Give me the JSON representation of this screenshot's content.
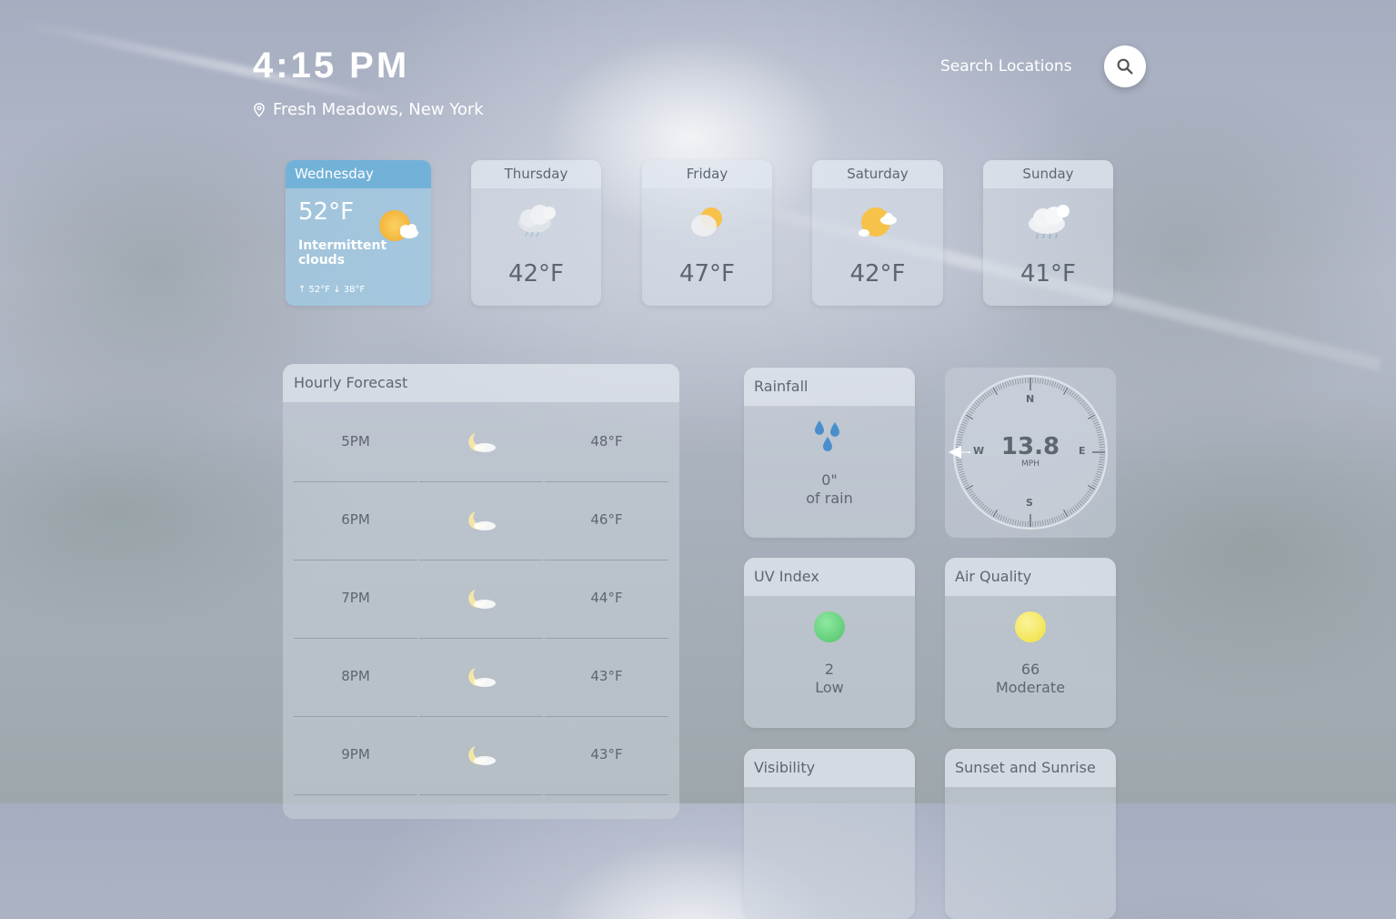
{
  "header": {
    "time": "4:15 PM",
    "location": "Fresh Meadows, New York",
    "search_label": "Search Locations"
  },
  "current": {
    "day": "Wednesday",
    "temp": "52°F",
    "condition": "Intermittent clouds",
    "high_low": "↑ 52°F ↓ 38°F",
    "icon": "sun-cloud-icon"
  },
  "days": [
    {
      "name": "Thursday",
      "temp": "42°F",
      "icon": "cloud-rain-icon"
    },
    {
      "name": "Friday",
      "temp": "47°F",
      "icon": "hazy-sun-icon"
    },
    {
      "name": "Saturday",
      "temp": "42°F",
      "icon": "sun-cloud-icon"
    },
    {
      "name": "Sunday",
      "temp": "41°F",
      "icon": "cloud-rain-icon"
    }
  ],
  "hourly": {
    "title": "Hourly Forecast",
    "rows": [
      {
        "time": "5PM",
        "temp": "48°F",
        "icon": "moon-cloud-icon"
      },
      {
        "time": "6PM",
        "temp": "46°F",
        "icon": "moon-cloud-icon"
      },
      {
        "time": "7PM",
        "temp": "44°F",
        "icon": "moon-cloud-icon"
      },
      {
        "time": "8PM",
        "temp": "43°F",
        "icon": "moon-cloud-icon"
      },
      {
        "time": "9PM",
        "temp": "43°F",
        "icon": "moon-cloud-icon"
      }
    ]
  },
  "rainfall": {
    "title": "Rainfall",
    "amount": "0\"",
    "label": "of rain",
    "icon": "raindrops-icon",
    "color": "#4a90c8"
  },
  "wind": {
    "speed": "13.8",
    "unit": "MPH",
    "n": "N",
    "e": "E",
    "s": "S",
    "w": "W",
    "direction": "W"
  },
  "uv": {
    "title": "UV Index",
    "value": "2",
    "label": "Low",
    "color": "#5fd37a"
  },
  "air": {
    "title": "Air Quality",
    "value": "66",
    "label": "Moderate",
    "color": "#f2e44a"
  },
  "visibility": {
    "title": "Visibility"
  },
  "sun": {
    "title": "Sunset and Sunrise"
  }
}
